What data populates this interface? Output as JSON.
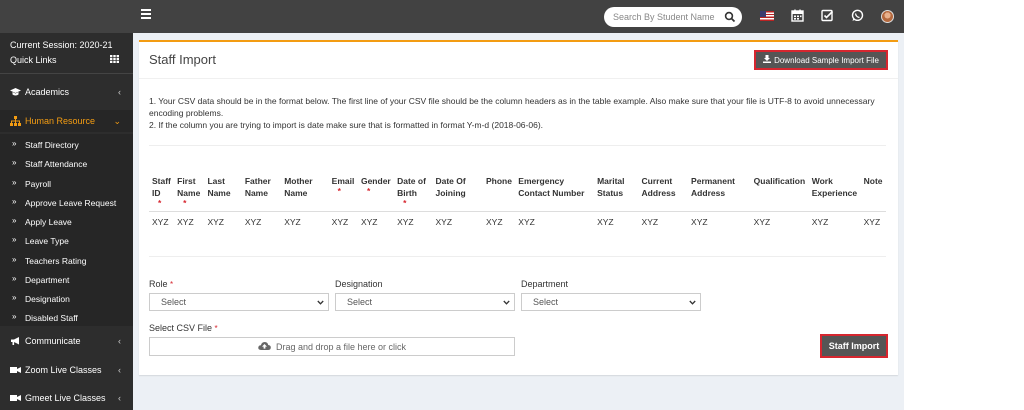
{
  "topbar": {
    "search_placeholder": "Search By Student Name",
    "icons": [
      "menu-icon",
      "search-icon",
      "flag-icon",
      "calendar-icon",
      "checklist-icon",
      "whatsapp-icon",
      "user-avatar"
    ]
  },
  "sidebar": {
    "session": "Current Session: 2020-21",
    "quick_links": "Quick Links",
    "menu": {
      "academics": "Academics",
      "human_resource": "Human Resource",
      "communicate": "Communicate",
      "zoom": "Zoom Live Classes",
      "gmeet": "Gmeet Live Classes"
    },
    "submenu": [
      "Staff Directory",
      "Staff Attendance",
      "Payroll",
      "Approve Leave Request",
      "Apply Leave",
      "Leave Type",
      "Teachers Rating",
      "Department",
      "Designation",
      "Disabled Staff"
    ],
    "chevron": "‹",
    "chevron_active": "⌄",
    "arrow": "»"
  },
  "panel": {
    "title": "Staff Import",
    "download_label": "Download Sample Import File",
    "instruction_1": "1. Your CSV data should be in the format below. The first line of your CSV file should be the column headers as in the table example. Also make sure that your file is UTF-8 to avoid unnecessary encoding problems.",
    "instruction_2": "2. If the column you are trying to import is date make sure that is formatted in format Y-m-d (2018-06-06).",
    "required_mark": "*"
  },
  "table": {
    "columns": [
      {
        "label": "Staff ID",
        "required": true
      },
      {
        "label": "First Name",
        "required": true
      },
      {
        "label": "Last Name",
        "required": false
      },
      {
        "label": "Father Name",
        "required": false
      },
      {
        "label": "Mother Name",
        "required": false
      },
      {
        "label": "Email",
        "required": true
      },
      {
        "label": "Gender",
        "required": true
      },
      {
        "label": "Date of Birth",
        "required": true
      },
      {
        "label": "Date Of Joining",
        "required": false
      },
      {
        "label": "Phone",
        "required": false
      },
      {
        "label": "Emergency Contact Number",
        "required": false
      },
      {
        "label": "Marital Status",
        "required": false
      },
      {
        "label": "Current Address",
        "required": false
      },
      {
        "label": "Permanent Address",
        "required": false
      },
      {
        "label": "Qualification",
        "required": false
      },
      {
        "label": "Work Experience",
        "required": false
      },
      {
        "label": "Note",
        "required": false
      }
    ],
    "row_value": "XYZ"
  },
  "form": {
    "role_label": "Role",
    "designation_label": "Designation",
    "department_label": "Department",
    "select_placeholder": "Select",
    "csv_label": "Select CSV File",
    "dropzone_text": "Drag and drop a file here or click",
    "import_label": "Staff Import"
  },
  "colors": {
    "accent": "#f39c12",
    "highlight": "#d6262f",
    "sidebar": "#2d2d2d",
    "topbar": "#424242"
  }
}
